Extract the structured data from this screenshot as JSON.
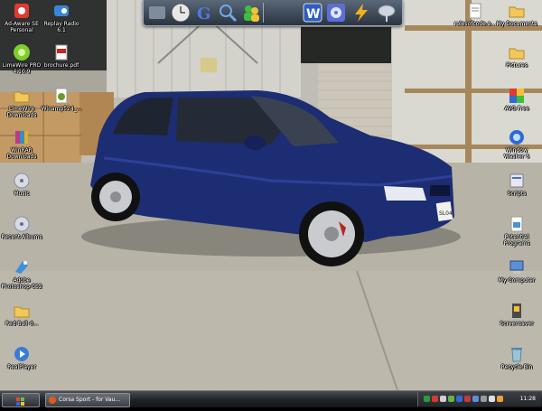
{
  "desktop": {
    "left_icons": [
      {
        "icon": "adaware-icon",
        "line1": "Ad-Aware SE",
        "line2": "Personal"
      },
      {
        "icon": "limewire-icon",
        "line1": "LimeWire PRO",
        "line2": "4.10.9"
      },
      {
        "icon": "folder-icon",
        "line1": "LimeWire",
        "line2": "Downloads"
      },
      {
        "icon": "winrar-icon",
        "line1": "WinRAR",
        "line2": "Downloads"
      },
      {
        "icon": "music-cd-icon",
        "line1": "Music",
        "line2": ""
      },
      {
        "icon": "music-cd-icon",
        "line1": "Recent Albums",
        "line2": ""
      },
      {
        "icon": "photoshop-icon",
        "line1": "Adobe",
        "line2": "Photoshop CS2"
      },
      {
        "icon": "folder-icon",
        "line1": "Red Bull d...",
        "line2": ""
      },
      {
        "icon": "realplayer-icon",
        "line1": "RealPlayer",
        "line2": ""
      }
    ],
    "second_column_icons": [
      {
        "icon": "replay-radio-icon",
        "line1": "Replay Radio",
        "line2": "6.1"
      },
      {
        "icon": "pdf-icon",
        "line1": "brochure.pdf",
        "line2": ""
      },
      {
        "icon": "media-file-icon",
        "line1": "Winamp524_...",
        "line2": ""
      }
    ],
    "right_icons": [
      {
        "icon": "document-icon",
        "line1": "rulesofcode.a...",
        "line2": ""
      },
      {
        "icon": "folder-icon",
        "line1": "My Documents",
        "line2": ""
      },
      {
        "icon": "folder-icon",
        "line1": "Pictures",
        "line2": ""
      },
      {
        "icon": "avg-icon",
        "line1": "AVG Free",
        "line2": ""
      },
      {
        "icon": "windows-washer-icon",
        "line1": "Window",
        "line2": "Washer 5"
      },
      {
        "icon": "script-icon",
        "line1": "Scripts",
        "line2": ""
      },
      {
        "icon": "programs-icon",
        "line1": "Potential",
        "line2": "Programs"
      },
      {
        "icon": "my-computer-icon",
        "line1": "My Computer",
        "line2": ""
      },
      {
        "icon": "screensaver-icon",
        "line1": "Screensaver",
        "line2": ""
      },
      {
        "icon": "recycle-bin-icon",
        "line1": "Recycle Bin",
        "line2": ""
      }
    ]
  },
  "dock": {
    "items": [
      "clock-icon",
      "google-icon",
      "search-tool-icon",
      "users-icon",
      "word-icon",
      "media-player-icon",
      "lightning-icon",
      "satellite-icon"
    ]
  },
  "taskbar": {
    "window_title": "Corsa Sport - for Vau...",
    "clock": "11:28",
    "tray_colors": [
      "#2e9b3a",
      "#d63a2f",
      "#d1d1d1",
      "#6ab04c",
      "#2f6ad6",
      "#c43a3a",
      "#5b8fd6",
      "#9a9a9a",
      "#e0e0e0",
      "#f0a030"
    ]
  },
  "wallpaper": {
    "plate": "SL04"
  }
}
